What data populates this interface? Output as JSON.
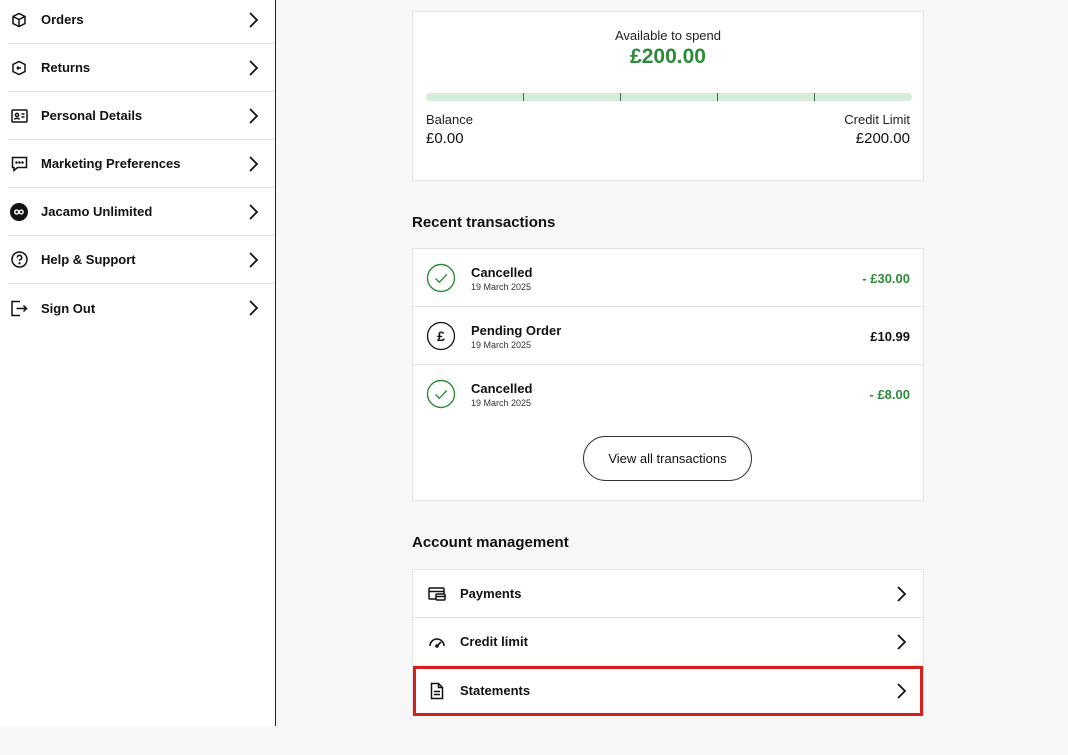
{
  "sidebar": {
    "items": [
      {
        "label": "Orders",
        "icon": "package-icon"
      },
      {
        "label": "Returns",
        "icon": "return-icon"
      },
      {
        "label": "Personal Details",
        "icon": "id-card-icon"
      },
      {
        "label": "Marketing Preferences",
        "icon": "chat-icon"
      },
      {
        "label": "Jacamo Unlimited",
        "icon": "infinity-icon"
      },
      {
        "label": "Help & Support",
        "icon": "help-icon"
      },
      {
        "label": "Sign Out",
        "icon": "sign-out-icon"
      }
    ]
  },
  "available": {
    "label": "Available to spend",
    "amount": "£200.00",
    "balance_label": "Balance",
    "balance_value": "£0.00",
    "limit_label": "Credit Limit",
    "limit_value": "£200.00",
    "used_fraction": 0
  },
  "transactions": {
    "title": "Recent transactions",
    "items": [
      {
        "title": "Cancelled",
        "date": "19 March 2025",
        "amount": "- £30.00",
        "status": "cancelled"
      },
      {
        "title": "Pending Order",
        "date": "19 March 2025",
        "amount": "£10.99",
        "status": "pending"
      },
      {
        "title": "Cancelled",
        "date": "19 March 2025",
        "amount": "- £8.00",
        "status": "cancelled"
      }
    ],
    "view_all_label": "View all transactions"
  },
  "account": {
    "title": "Account management",
    "items": [
      {
        "label": "Payments",
        "icon": "card-icon"
      },
      {
        "label": "Credit limit",
        "icon": "gauge-icon"
      },
      {
        "label": "Statements",
        "icon": "document-icon"
      }
    ]
  },
  "colors": {
    "accent_green": "#2e8b3a",
    "track_green": "#d6eddb",
    "highlight_red": "#d62020"
  }
}
